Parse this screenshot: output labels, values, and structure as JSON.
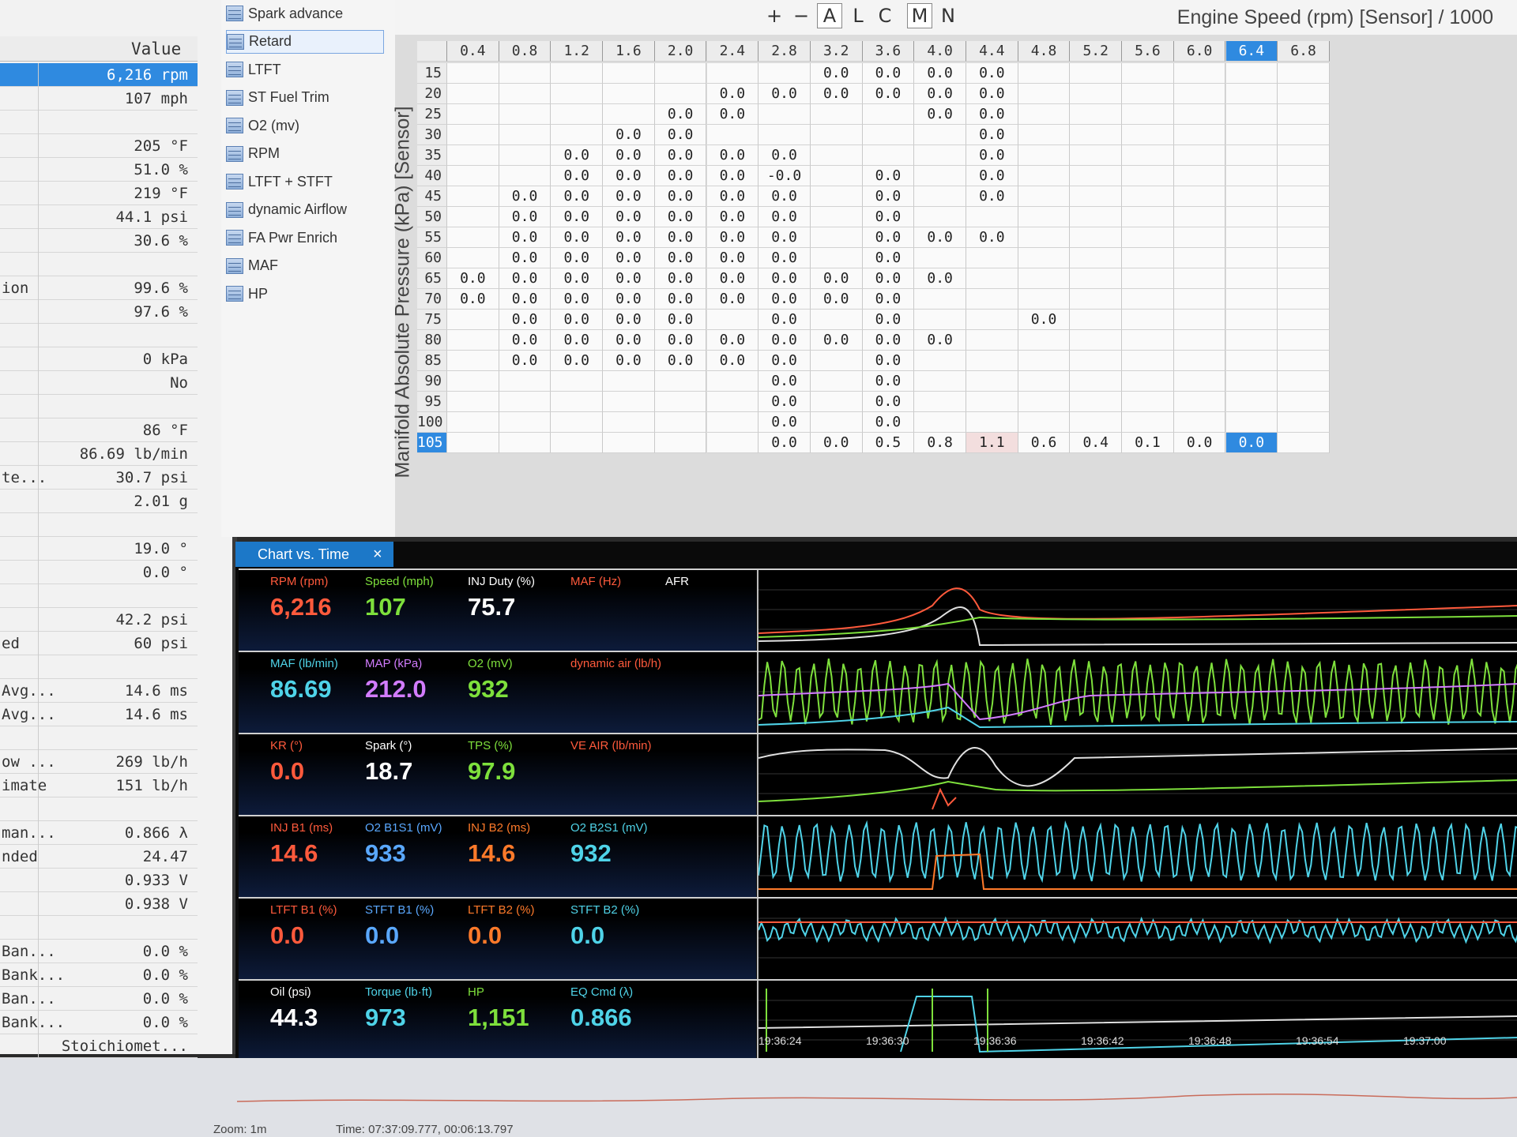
{
  "left_panel": {
    "header": "Value",
    "rows": [
      {
        "name": "",
        "value": "6,216 rpm",
        "selected": true
      },
      {
        "name": "",
        "value": "107 mph"
      },
      {
        "name": "",
        "value": ""
      },
      {
        "name": "",
        "value": "205 °F"
      },
      {
        "name": "",
        "value": "51.0 %"
      },
      {
        "name": "",
        "value": "219 °F"
      },
      {
        "name": "",
        "value": "44.1 psi"
      },
      {
        "name": "",
        "value": "30.6 %"
      },
      {
        "name": "",
        "value": ""
      },
      {
        "name": "ion",
        "value": "99.6 %"
      },
      {
        "name": "",
        "value": "97.6 %"
      },
      {
        "name": "",
        "value": ""
      },
      {
        "name": "",
        "value": "0 kPa"
      },
      {
        "name": "",
        "value": "No"
      },
      {
        "name": "",
        "value": ""
      },
      {
        "name": "",
        "value": "86 °F"
      },
      {
        "name": "",
        "value": "86.69 lb/min"
      },
      {
        "name": "te...",
        "value": "30.7 psi"
      },
      {
        "name": "",
        "value": "2.01 g"
      },
      {
        "name": "",
        "value": ""
      },
      {
        "name": "",
        "value": "19.0 °"
      },
      {
        "name": "",
        "value": "0.0 °"
      },
      {
        "name": "",
        "value": ""
      },
      {
        "name": "",
        "value": "42.2 psi"
      },
      {
        "name": "ed",
        "value": "60 psi"
      },
      {
        "name": "",
        "value": ""
      },
      {
        "name": "Avg...",
        "value": "14.6 ms"
      },
      {
        "name": "Avg...",
        "value": "14.6 ms"
      },
      {
        "name": "",
        "value": ""
      },
      {
        "name": "ow ...",
        "value": "269 lb/h"
      },
      {
        "name": "imate",
        "value": "151 lb/h"
      },
      {
        "name": "",
        "value": ""
      },
      {
        "name": "man...",
        "value": "0.866 λ"
      },
      {
        "name": "nded",
        "value": "24.47"
      },
      {
        "name": "",
        "value": "0.933 V"
      },
      {
        "name": "",
        "value": "0.938 V"
      },
      {
        "name": "",
        "value": ""
      },
      {
        "name": "Ban...",
        "value": "0.0 %"
      },
      {
        "name": "Bank...",
        "value": "0.0 %"
      },
      {
        "name": "Ban...",
        "value": "0.0 %"
      },
      {
        "name": "Bank...",
        "value": "0.0 %"
      },
      {
        "name": "",
        "value": "Stoichiomet..."
      }
    ]
  },
  "map_list": {
    "items": [
      {
        "label": "Spark advance",
        "selected": false
      },
      {
        "label": "Retard",
        "selected": true
      },
      {
        "label": "LTFT",
        "selected": false
      },
      {
        "label": "ST Fuel Trim",
        "selected": false
      },
      {
        "label": "O2 (mv)",
        "selected": false
      },
      {
        "label": "RPM",
        "selected": false
      },
      {
        "label": "LTFT + STFT",
        "selected": false
      },
      {
        "label": "dynamic Airflow",
        "selected": false
      },
      {
        "label": "FA Pwr Enrich",
        "selected": false
      },
      {
        "label": "MAF",
        "selected": false
      },
      {
        "label": "HP",
        "selected": false
      }
    ]
  },
  "toolbar": {
    "buttons": [
      "+",
      "−",
      "A",
      "L",
      "C",
      "M",
      "N"
    ],
    "table_title": "Engine Speed (rpm) [Sensor] / 1000"
  },
  "table": {
    "y_axis_label": "Manifold Absolute Pressure (kPa) [Sensor]",
    "columns": [
      "0.4",
      "0.8",
      "1.2",
      "1.6",
      "2.0",
      "2.4",
      "2.8",
      "3.2",
      "3.6",
      "4.0",
      "4.4",
      "4.8",
      "5.2",
      "5.6",
      "6.0",
      "6.4",
      "6.8"
    ],
    "selected_column": 15,
    "selected_row": 18,
    "rows": [
      {
        "kpa": "15",
        "cells": [
          "",
          "",
          "",
          "",
          "",
          "",
          "",
          "0.0",
          "0.0",
          "0.0",
          "0.0",
          "",
          "",
          "",
          "",
          "",
          ""
        ]
      },
      {
        "kpa": "20",
        "cells": [
          "",
          "",
          "",
          "",
          "",
          "0.0",
          "0.0",
          "0.0",
          "0.0",
          "0.0",
          "0.0",
          "",
          "",
          "",
          "",
          "",
          ""
        ]
      },
      {
        "kpa": "25",
        "cells": [
          "",
          "",
          "",
          "",
          "0.0",
          "0.0",
          "",
          "",
          "",
          "0.0",
          "0.0",
          "",
          "",
          "",
          "",
          "",
          ""
        ]
      },
      {
        "kpa": "30",
        "cells": [
          "",
          "",
          "",
          "0.0",
          "0.0",
          "",
          "",
          "",
          "",
          "",
          "0.0",
          "",
          "",
          "",
          "",
          "",
          ""
        ]
      },
      {
        "kpa": "35",
        "cells": [
          "",
          "",
          "0.0",
          "0.0",
          "0.0",
          "0.0",
          "0.0",
          "",
          "",
          "",
          "0.0",
          "",
          "",
          "",
          "",
          "",
          ""
        ]
      },
      {
        "kpa": "40",
        "cells": [
          "",
          "",
          "0.0",
          "0.0",
          "0.0",
          "0.0",
          "-0.0",
          "",
          "0.0",
          "",
          "0.0",
          "",
          "",
          "",
          "",
          "",
          ""
        ]
      },
      {
        "kpa": "45",
        "cells": [
          "",
          "0.0",
          "0.0",
          "0.0",
          "0.0",
          "0.0",
          "0.0",
          "",
          "0.0",
          "",
          "0.0",
          "",
          "",
          "",
          "",
          "",
          ""
        ]
      },
      {
        "kpa": "50",
        "cells": [
          "",
          "0.0",
          "0.0",
          "0.0",
          "0.0",
          "0.0",
          "0.0",
          "",
          "0.0",
          "",
          "",
          "",
          "",
          "",
          "",
          "",
          ""
        ]
      },
      {
        "kpa": "55",
        "cells": [
          "",
          "0.0",
          "0.0",
          "0.0",
          "0.0",
          "0.0",
          "0.0",
          "",
          "0.0",
          "0.0",
          "0.0",
          "",
          "",
          "",
          "",
          "",
          ""
        ]
      },
      {
        "kpa": "60",
        "cells": [
          "",
          "0.0",
          "0.0",
          "0.0",
          "0.0",
          "0.0",
          "0.0",
          "",
          "0.0",
          "",
          "",
          "",
          "",
          "",
          "",
          "",
          ""
        ]
      },
      {
        "kpa": "65",
        "cells": [
          "0.0",
          "0.0",
          "0.0",
          "0.0",
          "0.0",
          "0.0",
          "0.0",
          "0.0",
          "0.0",
          "0.0",
          "",
          "",
          "",
          "",
          "",
          "",
          ""
        ]
      },
      {
        "kpa": "70",
        "cells": [
          "0.0",
          "0.0",
          "0.0",
          "0.0",
          "0.0",
          "0.0",
          "0.0",
          "0.0",
          "0.0",
          "",
          "",
          "",
          "",
          "",
          "",
          "",
          ""
        ]
      },
      {
        "kpa": "75",
        "cells": [
          "",
          "0.0",
          "0.0",
          "0.0",
          "0.0",
          "",
          "0.0",
          "",
          "0.0",
          "",
          "",
          "0.0",
          "",
          "",
          "",
          "",
          ""
        ]
      },
      {
        "kpa": "80",
        "cells": [
          "",
          "0.0",
          "0.0",
          "0.0",
          "0.0",
          "0.0",
          "0.0",
          "0.0",
          "0.0",
          "0.0",
          "",
          "",
          "",
          "",
          "",
          "",
          ""
        ]
      },
      {
        "kpa": "85",
        "cells": [
          "",
          "0.0",
          "0.0",
          "0.0",
          "0.0",
          "0.0",
          "0.0",
          "",
          "0.0",
          "",
          "",
          "",
          "",
          "",
          "",
          "",
          ""
        ]
      },
      {
        "kpa": "90",
        "cells": [
          "",
          "",
          "",
          "",
          "",
          "",
          "0.0",
          "",
          "0.0",
          "",
          "",
          "",
          "",
          "",
          "",
          "",
          ""
        ]
      },
      {
        "kpa": "95",
        "cells": [
          "",
          "",
          "",
          "",
          "",
          "",
          "0.0",
          "",
          "0.0",
          "",
          "",
          "",
          "",
          "",
          "",
          "",
          ""
        ]
      },
      {
        "kpa": "100",
        "cells": [
          "",
          "",
          "",
          "",
          "",
          "",
          "0.0",
          "",
          "0.0",
          "",
          "",
          "",
          "",
          "",
          "",
          "",
          ""
        ]
      },
      {
        "kpa": "105",
        "cells": [
          "",
          "",
          "",
          "",
          "",
          "",
          "0.0",
          "0.0",
          "0.5",
          "0.8",
          "1.1",
          "0.6",
          "0.4",
          "0.1",
          "0.0",
          "0.0",
          ""
        ]
      }
    ],
    "highlight_cell": {
      "row": 18,
      "col": 10
    }
  },
  "chart_panel": {
    "tab_label": "Chart vs. Time",
    "tab_close": "×",
    "rows": [
      {
        "gauges": [
          {
            "label": "RPM (rpm)",
            "value": "6,216",
            "color": "#ff5a3c"
          },
          {
            "label": "Speed (mph)",
            "value": "107",
            "color": "#7ee03c"
          },
          {
            "label": "INJ Duty (%)",
            "value": "75.7",
            "color": "#ffffff"
          },
          {
            "label": "MAF (Hz)",
            "value": "",
            "color": "#ff5a3c"
          },
          {
            "label": "AFR",
            "value": "",
            "color": "#ffffff"
          }
        ]
      },
      {
        "gauges": [
          {
            "label": "MAF (lb/min)",
            "value": "86.69",
            "color": "#4fd3e8"
          },
          {
            "label": "MAP (kPa)",
            "value": "212.0",
            "color": "#d27cff"
          },
          {
            "label": "O2 (mV)",
            "value": "932",
            "color": "#7ee03c"
          },
          {
            "label": "dynamic air (lb/h)",
            "value": "",
            "color": "#ff5a3c"
          }
        ]
      },
      {
        "gauges": [
          {
            "label": "KR (°)",
            "value": "0.0",
            "color": "#ff5a3c"
          },
          {
            "label": "Spark (°)",
            "value": "18.7",
            "color": "#ffffff"
          },
          {
            "label": "TPS (%)",
            "value": "97.9",
            "color": "#7ee03c"
          },
          {
            "label": "VE AIR (lb/min)",
            "value": "",
            "color": "#ff5a3c"
          }
        ]
      },
      {
        "gauges": [
          {
            "label": "INJ B1 (ms)",
            "value": "14.6",
            "color": "#ff5a3c"
          },
          {
            "label": "O2 B1S1 (mV)",
            "value": "933",
            "color": "#5aa8ff"
          },
          {
            "label": "INJ B2 (ms)",
            "value": "14.6",
            "color": "#ff7a2a"
          },
          {
            "label": "O2 B2S1 (mV)",
            "value": "932",
            "color": "#4fd3e8"
          }
        ]
      },
      {
        "gauges": [
          {
            "label": "LTFT B1 (%)",
            "value": "0.0",
            "color": "#ff5a3c"
          },
          {
            "label": "STFT B1 (%)",
            "value": "0.0",
            "color": "#5aa8ff"
          },
          {
            "label": "LTFT B2 (%)",
            "value": "0.0",
            "color": "#ff7a2a"
          },
          {
            "label": "STFT B2 (%)",
            "value": "0.0",
            "color": "#4fd3e8"
          }
        ]
      },
      {
        "gauges": [
          {
            "label": "Oil (psi)",
            "value": "44.3",
            "color": "#ffffff"
          },
          {
            "label": "Torque (lb·ft)",
            "value": "973",
            "color": "#4fd3e8"
          },
          {
            "label": "HP",
            "value": "1,151",
            "color": "#7ee03c"
          },
          {
            "label": "EQ Cmd (λ)",
            "value": "0.866",
            "color": "#4fd3e8"
          }
        ]
      }
    ],
    "time_ticks": [
      "19:36:24",
      "19:36:30",
      "19:36:36",
      "19:36:42",
      "19:36:48",
      "19:36:54",
      "19:37:00"
    ]
  },
  "status_bar": {
    "zoom": "Zoom: 1m",
    "time": "Time: 07:37:09.777, 00:06:13.797"
  }
}
